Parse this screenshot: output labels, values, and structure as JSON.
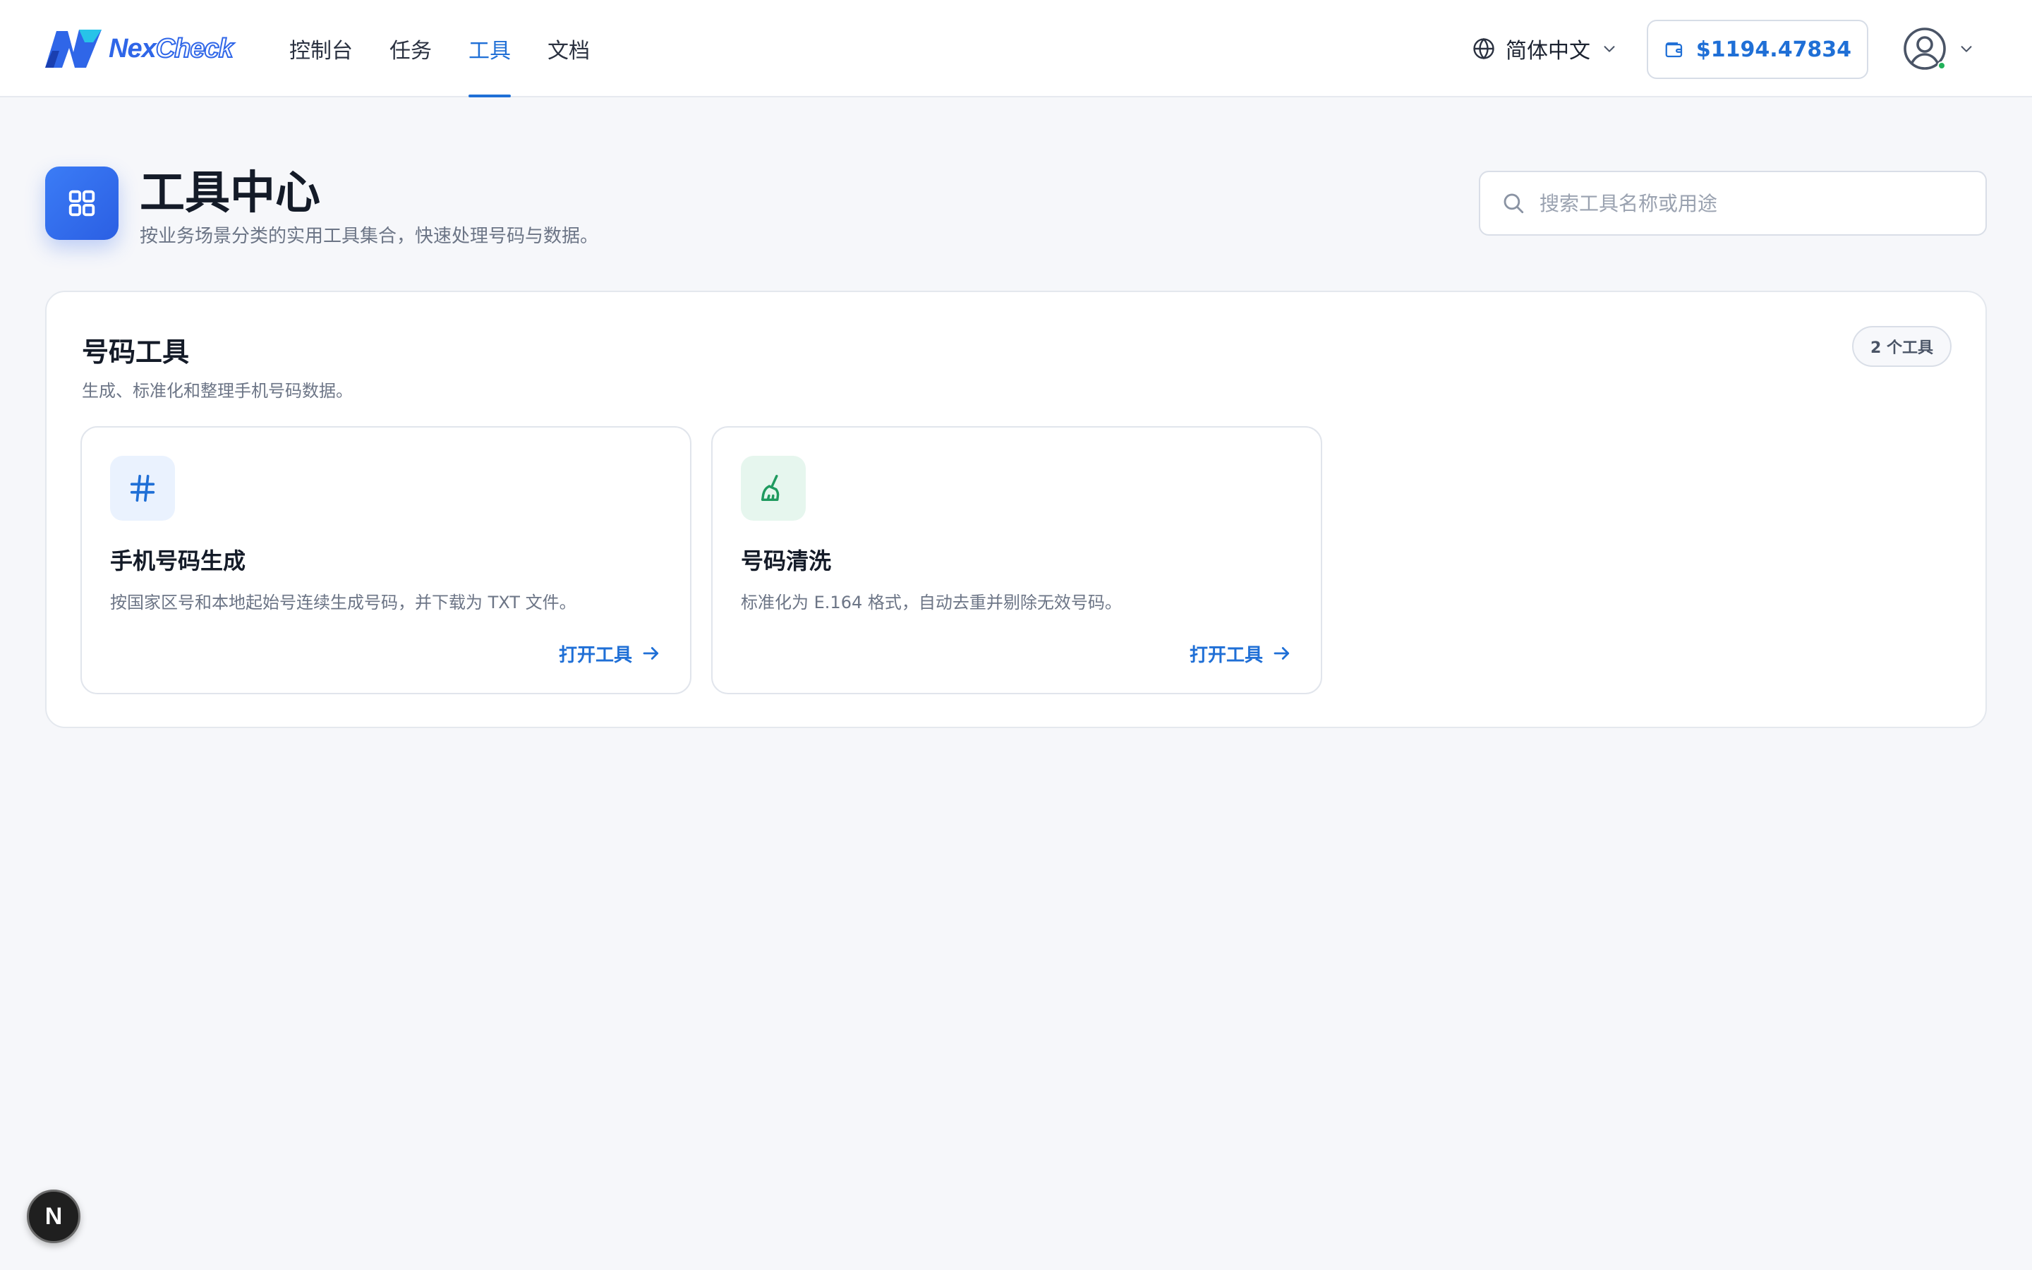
{
  "header": {
    "logo": {
      "part1": "Nex",
      "part2": "Check",
      "icon": "nexcheck-logo-icon"
    },
    "nav": [
      {
        "label": "控制台",
        "active": false
      },
      {
        "label": "任务",
        "active": false
      },
      {
        "label": "工具",
        "active": true
      },
      {
        "label": "文档",
        "active": false
      }
    ],
    "language": {
      "label": "简体中文",
      "icon": "globe-icon"
    },
    "wallet": {
      "amount": "$1194.47834",
      "icon": "wallet-icon"
    },
    "user": {
      "icon": "user-circle-icon",
      "status_color": "#22b15a"
    }
  },
  "page": {
    "icon": "grid-icon",
    "title": "工具中心",
    "subtitle": "按业务场景分类的实用工具集合，快速处理号码与数据。",
    "search": {
      "placeholder": "搜索工具名称或用途",
      "value": ""
    }
  },
  "section": {
    "title": "号码工具",
    "subtitle": "生成、标准化和整理手机号码数据。",
    "count": "2 个工具",
    "cards": [
      {
        "icon": "hash-icon",
        "icon_color": "#1f6fd6",
        "icon_bg": "#eaf2fe",
        "title": "手机号码生成",
        "description": "按国家区号和本地起始号连续生成号码，并下载为 TXT 文件。",
        "action": "打开工具"
      },
      {
        "icon": "broom-icon",
        "icon_color": "#1f9a5f",
        "icon_bg": "#e6f6ee",
        "title": "号码清洗",
        "description": "标准化为 E.164 格式，自动去重并剔除无效号码。",
        "action": "打开工具"
      }
    ]
  },
  "dev_badge": {
    "label": "N"
  },
  "colors": {
    "accent": "#1f6fd6",
    "brand": "#2f66e8",
    "background": "#f6f7fa"
  }
}
